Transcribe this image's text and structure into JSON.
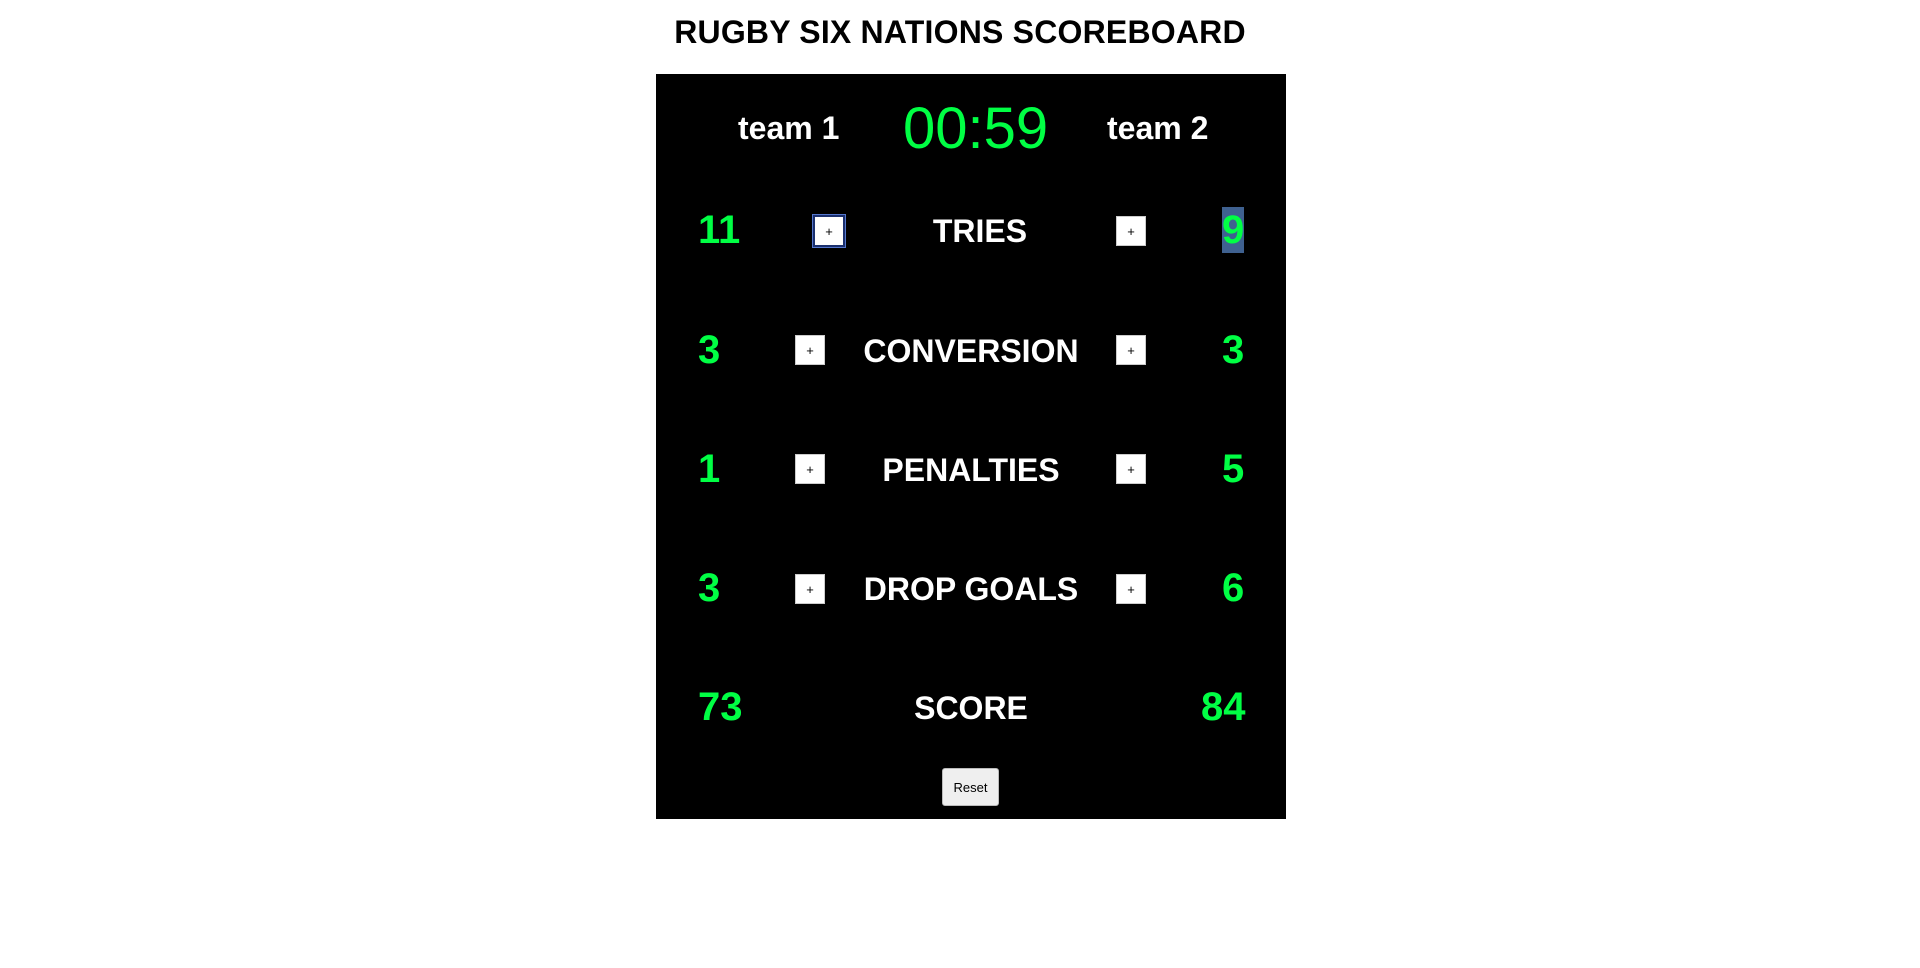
{
  "title": "RUGBY SIX NATIONS SCOREBOARD",
  "team1": {
    "name": "team 1"
  },
  "team2": {
    "name": "team 2"
  },
  "timer": "00:59",
  "rows": {
    "tries": {
      "label": "TRIES",
      "team1": "11",
      "team2": "9",
      "plus_label": "+"
    },
    "conversion": {
      "label": "CONVERSION",
      "team1": "3",
      "team2": "3",
      "plus_label": "+"
    },
    "penalties": {
      "label": "PENALTIES",
      "team1": "1",
      "team2": "5",
      "plus_label": "+"
    },
    "drop_goals": {
      "label": "DROP GOALS",
      "team1": "3",
      "team2": "6",
      "plus_label": "+"
    },
    "score": {
      "label": "SCORE",
      "team1": "73",
      "team2": "84"
    }
  },
  "reset_label": "Reset",
  "colors": {
    "accent_green": "#00ff44",
    "board_bg": "#000000",
    "label_white": "#ffffff"
  }
}
